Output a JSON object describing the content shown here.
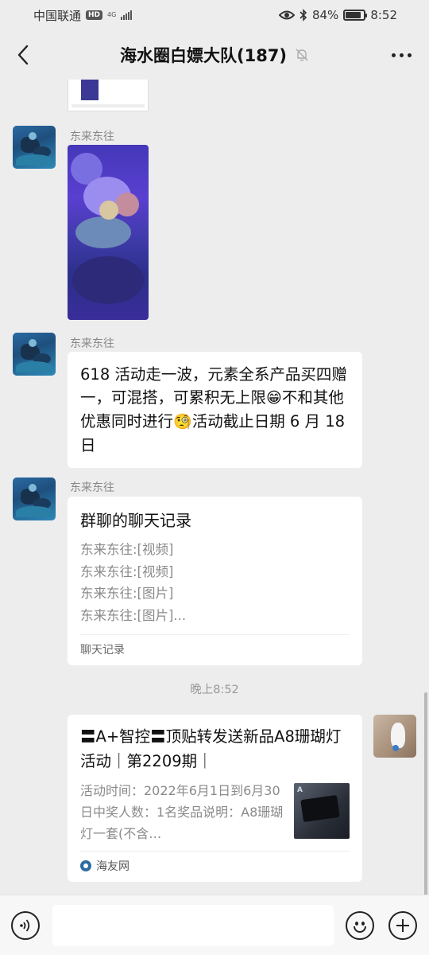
{
  "status_bar": {
    "carrier": "中国联通",
    "hd_badge": "HD",
    "network": "4G",
    "battery": "84%",
    "battery_level": 0.84,
    "time": "8:52"
  },
  "header": {
    "title": "海水圈白嫖大队(187)"
  },
  "messages": [
    {
      "sender": "东来东往",
      "type": "image"
    },
    {
      "sender": "东来东往",
      "type": "text",
      "text_part1": "618 活动走一波，元素全系产品买四赠一，可混搭，可累积无上限",
      "emoji1": "😁",
      "text_part2": "不和其他优惠同时进行",
      "emoji2": "🧐",
      "text_part3": "活动截止日期 6 月 18 日"
    },
    {
      "sender": "东来东往",
      "type": "chat_record",
      "title": "群聊的聊天记录",
      "lines": [
        "东来东往:[视频]",
        "东来东往:[视频]",
        "东来东往:[图片]",
        "东来东往:[图片]..."
      ],
      "footer": "聊天记录"
    }
  ],
  "timestamp": "晚上8:52",
  "link_card": {
    "title": "〓A+智控〓顶贴转发送新品A8珊瑚灯活动｜第2209期｜",
    "description": "活动时间：2022年6月1日到6月30日中奖人数：1名奖品说明：A8珊瑚灯一套(不含…",
    "thumb_label": "A",
    "source": "海友网"
  },
  "input_bar": {
    "value": ""
  }
}
